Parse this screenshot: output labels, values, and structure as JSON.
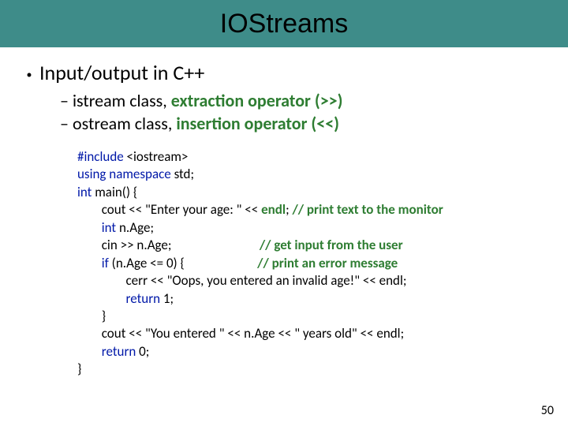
{
  "title": "IOStreams",
  "heading": "Input/output in C++",
  "sub1_prefix": "istream class, ",
  "sub1_em": "extraction operator (>>)",
  "sub2_prefix": "ostream class, ",
  "sub2_em": "insertion operator (<<)",
  "code": {
    "l1a": "#include",
    "l1b": " <iostream>",
    "l2a": "using namespace",
    "l2b": " std;",
    "l3a": "int",
    "l3b": " main() {",
    "l4a": "        cout << \"Enter your age: \" << ",
    "l4b": "endl",
    "l4c": "; ",
    "l4d": "// print text to the monitor",
    "l5a": "        ",
    "l5b": "int",
    "l5c": " n.Age;",
    "l6a": "        cin >> n.Age;                             ",
    "l6b": "// get input from the user",
    "l7a": "        ",
    "l7b": "if",
    "l7c": " (n.Age <= 0) {                        ",
    "l7d": "// print an error message",
    "l8": "                cerr << \"Oops, you entered an invalid age!\" << endl;",
    "l9a": "                ",
    "l9b": "return",
    "l9c": " 1;",
    "l10": "        }",
    "l11": "        cout << \"You entered \" << n.Age << \" years old\" << endl;",
    "l12a": "        ",
    "l12b": "return",
    "l12c": " 0;",
    "l13": "}"
  },
  "page_number": "50"
}
